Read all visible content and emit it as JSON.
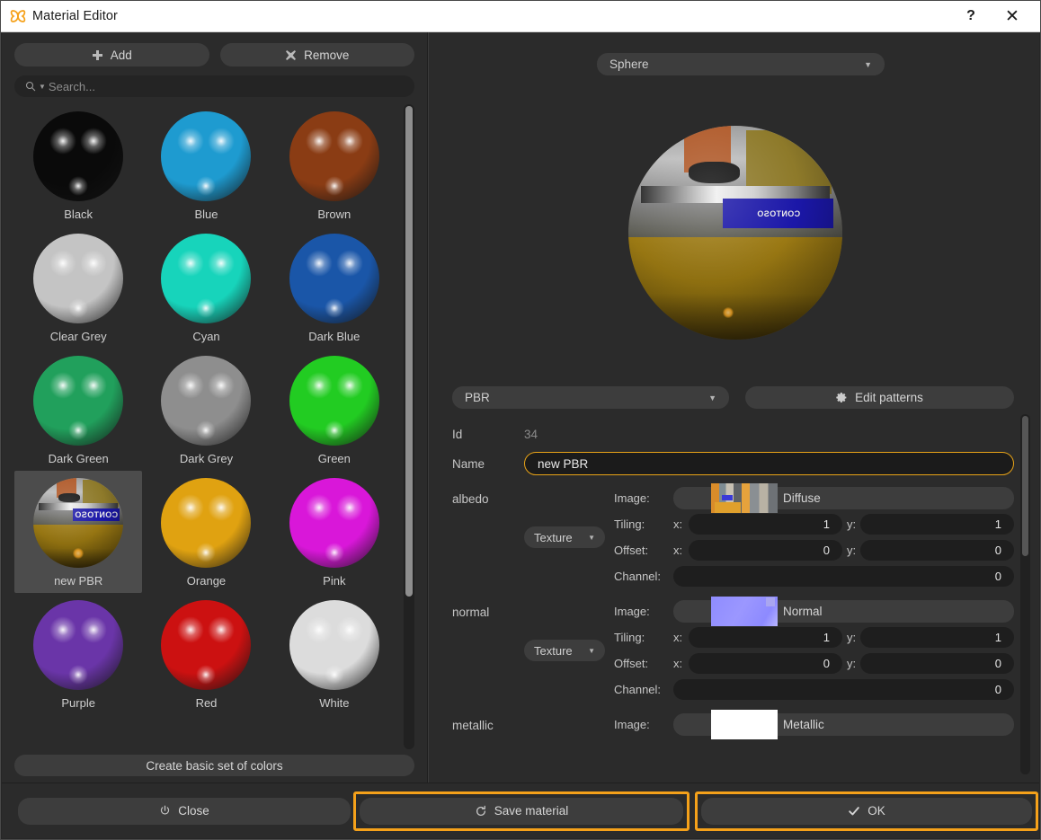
{
  "window": {
    "title": "Material Editor",
    "app_icon": "material-editor-icon",
    "help_button": "?",
    "close_button": "✕",
    "accent_color": "#f5a11a",
    "highlight_color": "#e8a317"
  },
  "left_panel": {
    "add_button": {
      "label": "Add",
      "icon": "plus-icon"
    },
    "remove_button": {
      "label": "Remove",
      "icon": "cross-icon"
    },
    "search": {
      "placeholder": "Search...",
      "value": "",
      "icon": "search-icon",
      "dropdown_icon": "chevron-down-icon"
    },
    "create_basic_button": "Create basic set of colors",
    "selected_material": "new PBR",
    "materials": [
      {
        "label": "Black",
        "color": "#0a0a0a",
        "type": "solid"
      },
      {
        "label": "Blue",
        "color": "#1e9bd0",
        "type": "solid"
      },
      {
        "label": "Brown",
        "color": "#8a3c14",
        "type": "solid"
      },
      {
        "label": "Clear Grey",
        "color": "#c4c4c4",
        "type": "solid"
      },
      {
        "label": "Cyan",
        "color": "#17d4bb",
        "type": "solid"
      },
      {
        "label": "Dark Blue",
        "color": "#1a56a8",
        "type": "solid"
      },
      {
        "label": "Dark Green",
        "color": "#21a05c",
        "type": "solid"
      },
      {
        "label": "Dark Grey",
        "color": "#8e8e8e",
        "type": "solid"
      },
      {
        "label": "Green",
        "color": "#22cc22",
        "type": "solid"
      },
      {
        "label": "new PBR",
        "color": "#8a6c0f",
        "type": "pbr",
        "sign_text": "CONTOSO"
      },
      {
        "label": "Orange",
        "color": "#e0a211",
        "type": "solid"
      },
      {
        "label": "Pink",
        "color": "#d917d9",
        "type": "solid"
      },
      {
        "label": "Purple",
        "color": "#6a35a8",
        "type": "solid"
      },
      {
        "label": "Red",
        "color": "#cc1111",
        "type": "solid"
      },
      {
        "label": "White",
        "color": "#dcdcdc",
        "type": "solid"
      }
    ]
  },
  "right_panel": {
    "shape_select": {
      "value": "Sphere",
      "icon": "chevron-down-icon"
    },
    "material_type_select": {
      "value": "PBR",
      "icon": "chevron-down-icon"
    },
    "edit_patterns_button": {
      "label": "Edit patterns",
      "icon": "gear-icon"
    },
    "preview": {
      "material": "new PBR",
      "sign_text": "CONTOSO"
    },
    "fields": {
      "id_label": "Id",
      "id_value": "34",
      "name_label": "Name",
      "name_value": "new PBR"
    },
    "channels": [
      {
        "name": "albedo",
        "source_select": "Texture",
        "image_label": "Image:",
        "image_name": "Diffuse",
        "image_thumb": "diffuse-texture-thumbnail",
        "tiling_label": "Tiling:",
        "offset_label": "Offset:",
        "channel_label": "Channel:",
        "x_label": "x:",
        "y_label": "y:",
        "tiling_x": "1",
        "tiling_y": "1",
        "offset_x": "0",
        "offset_y": "0",
        "channel_value": "0"
      },
      {
        "name": "normal",
        "source_select": "Texture",
        "image_label": "Image:",
        "image_name": "Normal",
        "image_thumb": "normal-map-thumbnail",
        "tiling_label": "Tiling:",
        "offset_label": "Offset:",
        "channel_label": "Channel:",
        "x_label": "x:",
        "y_label": "y:",
        "tiling_x": "1",
        "tiling_y": "1",
        "offset_x": "0",
        "offset_y": "0",
        "channel_value": "0"
      },
      {
        "name": "metallic",
        "image_label": "Image:",
        "image_name": "Metallic",
        "image_thumb": "metallic-map-thumbnail"
      }
    ]
  },
  "footer": {
    "close_button": {
      "label": "Close",
      "icon": "power-icon",
      "highlighted": false
    },
    "save_button": {
      "label": "Save material",
      "icon": "refresh-icon",
      "highlighted": true
    },
    "ok_button": {
      "label": "OK",
      "icon": "check-icon",
      "highlighted": true
    }
  }
}
